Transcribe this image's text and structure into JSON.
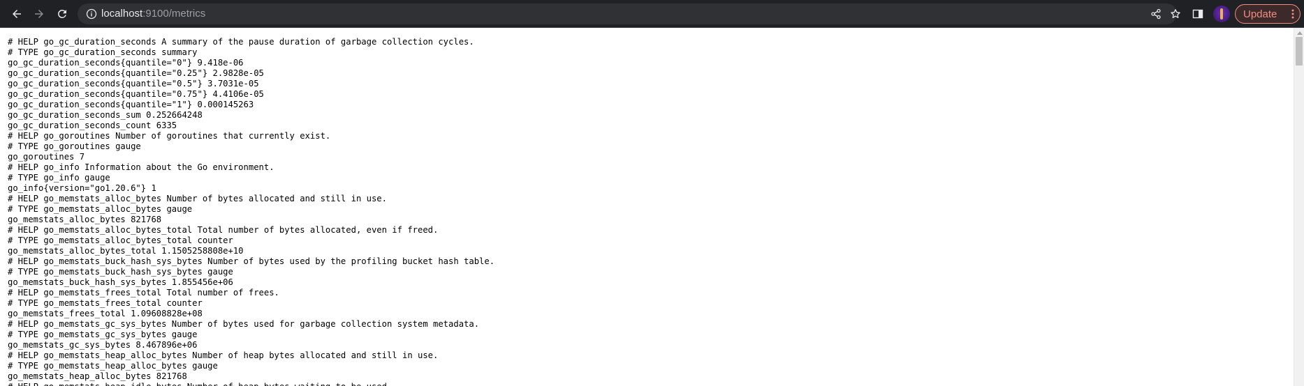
{
  "browser": {
    "url_host": "localhost",
    "url_rest": ":9100/metrics",
    "update_label": "Update",
    "icons": {
      "back": "arrow-left-icon",
      "forward": "arrow-right-icon",
      "reload": "reload-icon",
      "info": "info-icon",
      "share": "share-icon",
      "bookmark": "star-icon",
      "side_panel": "side-panel-icon",
      "menu": "vertical-dots-icon"
    },
    "colors": {
      "toolbar": "#202124",
      "omnibox": "#303134",
      "update_accent": "#f28b82"
    }
  },
  "metrics": {
    "lines": [
      "# HELP go_gc_duration_seconds A summary of the pause duration of garbage collection cycles.",
      "# TYPE go_gc_duration_seconds summary",
      "go_gc_duration_seconds{quantile=\"0\"} 9.418e-06",
      "go_gc_duration_seconds{quantile=\"0.25\"} 2.9828e-05",
      "go_gc_duration_seconds{quantile=\"0.5\"} 3.7031e-05",
      "go_gc_duration_seconds{quantile=\"0.75\"} 4.4106e-05",
      "go_gc_duration_seconds{quantile=\"1\"} 0.000145263",
      "go_gc_duration_seconds_sum 0.252664248",
      "go_gc_duration_seconds_count 6335",
      "# HELP go_goroutines Number of goroutines that currently exist.",
      "# TYPE go_goroutines gauge",
      "go_goroutines 7",
      "# HELP go_info Information about the Go environment.",
      "# TYPE go_info gauge",
      "go_info{version=\"go1.20.6\"} 1",
      "# HELP go_memstats_alloc_bytes Number of bytes allocated and still in use.",
      "# TYPE go_memstats_alloc_bytes gauge",
      "go_memstats_alloc_bytes 821768",
      "# HELP go_memstats_alloc_bytes_total Total number of bytes allocated, even if freed.",
      "# TYPE go_memstats_alloc_bytes_total counter",
      "go_memstats_alloc_bytes_total 1.1505258808e+10",
      "# HELP go_memstats_buck_hash_sys_bytes Number of bytes used by the profiling bucket hash table.",
      "# TYPE go_memstats_buck_hash_sys_bytes gauge",
      "go_memstats_buck_hash_sys_bytes 1.855456e+06",
      "# HELP go_memstats_frees_total Total number of frees.",
      "# TYPE go_memstats_frees_total counter",
      "go_memstats_frees_total 1.09608828e+08",
      "# HELP go_memstats_gc_sys_bytes Number of bytes used for garbage collection system metadata.",
      "# TYPE go_memstats_gc_sys_bytes gauge",
      "go_memstats_gc_sys_bytes 8.467896e+06",
      "# HELP go_memstats_heap_alloc_bytes Number of heap bytes allocated and still in use.",
      "# TYPE go_memstats_heap_alloc_bytes gauge",
      "go_memstats_heap_alloc_bytes 821768",
      "# HELP go_memstats_heap_idle_bytes Number of heap bytes waiting to be used."
    ]
  }
}
